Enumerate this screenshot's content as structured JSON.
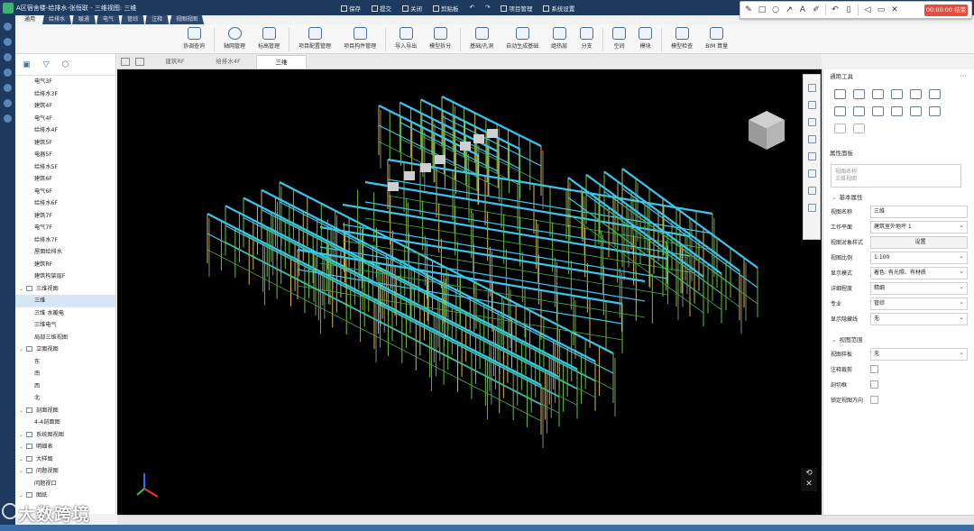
{
  "titlebar": {
    "title": "A区宿舍楼-给排水-张恒联 - 三维视图: 三维",
    "quick": [
      "保存",
      "提交",
      "关闭",
      "剪贴板",
      "项目管理",
      "系统设置"
    ]
  },
  "drawtools": {
    "icons": [
      "pen-icon",
      "rect-icon",
      "circle-icon",
      "arrow-icon",
      "text-icon",
      "marker-icon",
      "undo-icon",
      "trash-icon",
      "speaker-icon",
      "camera-icon",
      "close-icon"
    ],
    "rec_label": "00:00:00 结束"
  },
  "tabs": [
    "通用",
    "给排水",
    "暖通",
    "电气",
    "管综",
    "注释",
    "视图视图"
  ],
  "ribbon": [
    {
      "label": "协调查询"
    },
    {
      "label": "轴网管理"
    },
    {
      "label": "标高管理"
    },
    {
      "label": "项目配置管理"
    },
    {
      "label": "项目构件管理"
    },
    {
      "label": "导入导出"
    },
    {
      "label": "模型拆分"
    },
    {
      "label": "基础/孔洞"
    },
    {
      "label": "自动生成基础"
    },
    {
      "label": "绝热层"
    },
    {
      "label": "分支"
    },
    {
      "label": "空间"
    },
    {
      "label": "模块"
    },
    {
      "label": "模型检查"
    },
    {
      "label": "BIM 算量"
    }
  ],
  "tree": [
    {
      "label": "电气3F",
      "level": 1
    },
    {
      "label": "给排水3F",
      "level": 1
    },
    {
      "label": "建筑4F",
      "level": 1
    },
    {
      "label": "电气4F",
      "level": 1
    },
    {
      "label": "给排水4F",
      "level": 1
    },
    {
      "label": "建筑5F",
      "level": 1
    },
    {
      "label": "电器5F",
      "level": 1
    },
    {
      "label": "给排水5F",
      "level": 1
    },
    {
      "label": "建筑6F",
      "level": 1
    },
    {
      "label": "电气6F",
      "level": 1
    },
    {
      "label": "给排水6F",
      "level": 1
    },
    {
      "label": "建筑7F",
      "level": 1
    },
    {
      "label": "电气7F",
      "level": 1
    },
    {
      "label": "给排水7F",
      "level": 1
    },
    {
      "label": "屋面给排水",
      "level": 1
    },
    {
      "label": "建筑RF",
      "level": 1
    },
    {
      "label": "建筑构架层F",
      "level": 1
    },
    {
      "label": "三维视图",
      "level": 0
    },
    {
      "label": "三维",
      "level": 1,
      "selected": true
    },
    {
      "label": "三维 水暖电",
      "level": 1
    },
    {
      "label": "三维电气",
      "level": 1
    },
    {
      "label": "局部三维视图",
      "level": 1
    },
    {
      "label": "立面视图",
      "level": 0
    },
    {
      "label": "东",
      "level": 1
    },
    {
      "label": "南",
      "level": 1
    },
    {
      "label": "西",
      "level": 1
    },
    {
      "label": "北",
      "level": 1
    },
    {
      "label": "剖面视图",
      "level": 0
    },
    {
      "label": "4-4剖面图",
      "level": 1
    },
    {
      "label": "系统图视图",
      "level": 0
    },
    {
      "label": "明细表",
      "level": 0
    },
    {
      "label": "大样图",
      "level": 0
    },
    {
      "label": "问题视图",
      "level": 0
    },
    {
      "label": "问题视口",
      "level": 1
    },
    {
      "label": "图纸",
      "level": 0
    }
  ],
  "viewtabs": [
    "建筑RF",
    "给排水4F",
    "三维"
  ],
  "rightpanel": {
    "tools_title": "通用工具",
    "props_title": "属性面板",
    "view_select": [
      "视图名称",
      "三维视图"
    ],
    "basic_section": "基本属性",
    "props": [
      {
        "label": "视图名称",
        "value": "三维",
        "type": "text"
      },
      {
        "label": "工作平面",
        "value": "建筑室外地坪 1",
        "type": "dd"
      },
      {
        "label": "视图对象样式",
        "value": "设置",
        "type": "btn"
      },
      {
        "label": "视图比例",
        "value": "1:100",
        "type": "dd"
      },
      {
        "label": "显示模式",
        "value": "着色: 有光照、有材质",
        "type": "dd"
      },
      {
        "label": "详细程度",
        "value": "精细",
        "type": "dd"
      },
      {
        "label": "专业",
        "value": "管综",
        "type": "dd"
      },
      {
        "label": "显示隐藏线",
        "value": "无",
        "type": "dd"
      }
    ],
    "range_section": "视图范围",
    "range_props": [
      {
        "label": "视图样板",
        "value": "无",
        "type": "dd"
      },
      {
        "label": "注释裁剪",
        "type": "cb"
      },
      {
        "label": "剖切框",
        "type": "cb"
      },
      {
        "label": "锁定视图方向",
        "type": "cb"
      }
    ]
  },
  "watermark": "大数跨境",
  "colors": {
    "pipe": "#39c6f0",
    "green": "#6fbf3a",
    "accent": "#1f3a5f"
  }
}
